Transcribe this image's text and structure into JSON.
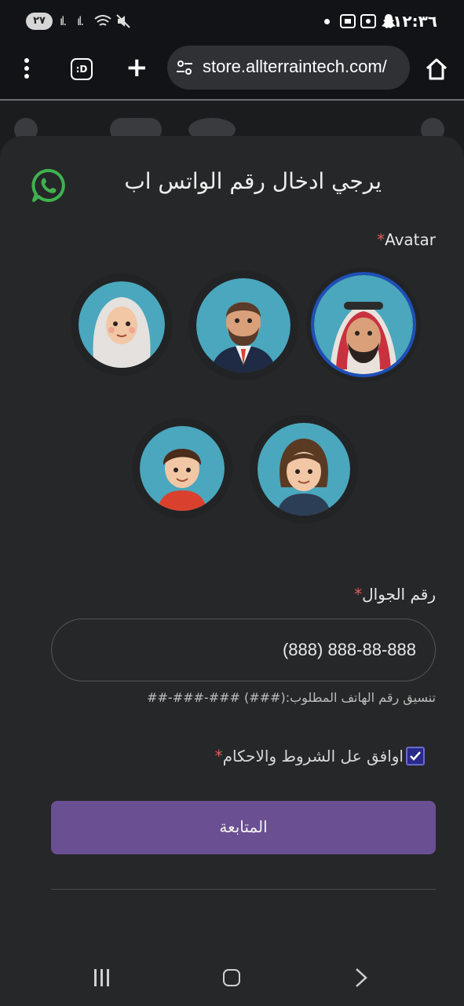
{
  "status_bar": {
    "battery": "٢٧",
    "time": "١٢:٣٦",
    "icons": [
      "signal-icon",
      "signal-icon",
      "wifi-icon",
      "mute-icon",
      "dot-icon",
      "screenshot-icon",
      "screen-record-icon",
      "snapchat-icon"
    ]
  },
  "browser": {
    "url": "store.allterraintech.com/",
    "tabs_label": ":D"
  },
  "dialog": {
    "title": "يرجي ادخال رقم الواتس اب",
    "avatar_label": "Avatar",
    "required_mark": "*",
    "avatars": [
      {
        "name": "avatar-saudi-man",
        "selected": true
      },
      {
        "name": "avatar-businessman",
        "selected": false
      },
      {
        "name": "avatar-hijab-woman",
        "selected": false
      },
      {
        "name": "avatar-girl",
        "selected": false
      },
      {
        "name": "avatar-boy",
        "selected": false
      }
    ],
    "phone_label": "رقم الجوال",
    "phone_value": "(888) 888-88-888",
    "phone_hint": "تنسيق رقم الهاتف المطلوب:(###) ###-###-##",
    "agree_label": "اوافق عل الشروط والاحكام",
    "agree_checked": true,
    "submit_label": "المتابعة"
  },
  "colors": {
    "accent": "#6b4f93",
    "whatsapp": "#3fb24f",
    "selected_ring": "#1e4fb8",
    "required": "#e05c5c"
  }
}
